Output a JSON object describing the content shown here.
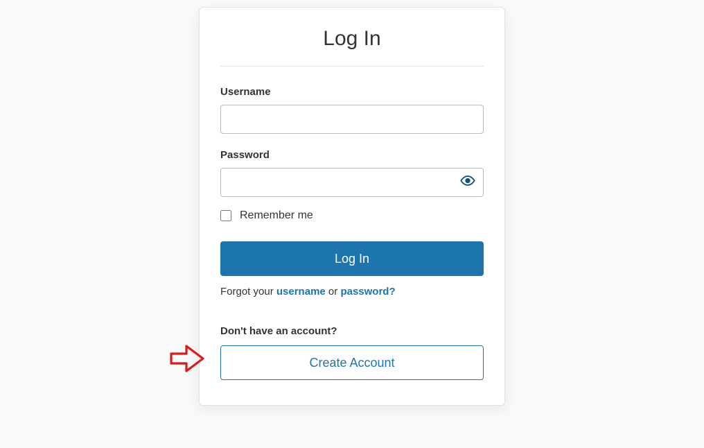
{
  "title": "Log In",
  "fields": {
    "username_label": "Username",
    "username_value": "",
    "password_label": "Password",
    "password_value": ""
  },
  "remember_label": "Remember me",
  "login_button": "Log In",
  "forgot": {
    "prefix": "Forgot your ",
    "username_link": "username",
    "or": " or ",
    "password_link": "password?"
  },
  "no_account_label": "Don't have an account?",
  "create_account_button": "Create Account"
}
